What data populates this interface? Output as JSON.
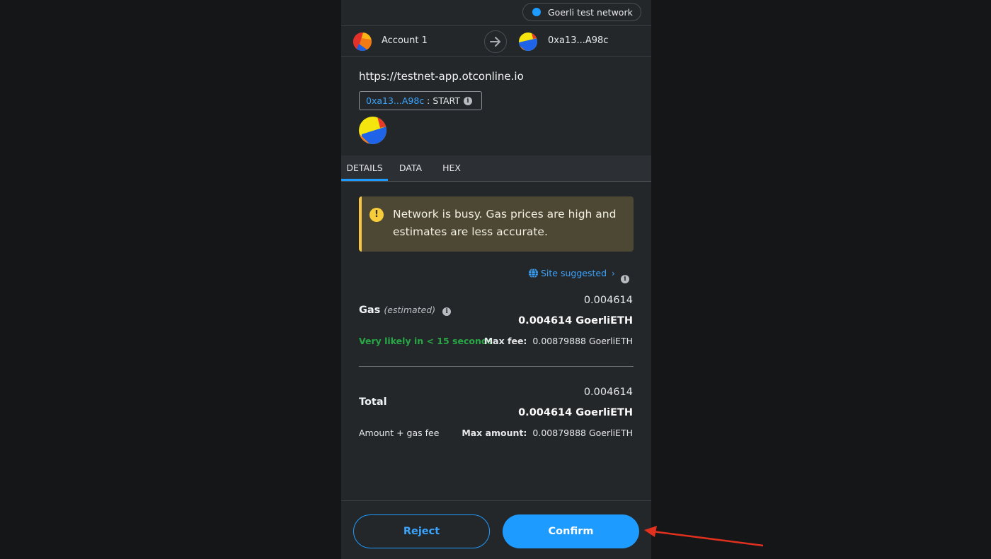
{
  "network": {
    "label": "Goerli test network",
    "dot_color": "#1e9bff"
  },
  "accounts": {
    "from_label": "Account 1",
    "to_label": "0xa13...A98c",
    "avatar_icon": "jazzicon-avatar",
    "arrow_icon": "arrow-right-icon"
  },
  "origin": "https://testnet-app.otconline.io",
  "method": {
    "address": "0xa13...A98c",
    "separator": ":",
    "name": "START",
    "info_icon": "i"
  },
  "tabs": [
    {
      "label": "DETAILS",
      "active": true
    },
    {
      "label": "DATA",
      "active": false
    },
    {
      "label": "HEX",
      "active": false
    }
  ],
  "warning": {
    "icon": "!",
    "text": "Network is busy. Gas prices are high and estimates are less accurate."
  },
  "site_suggested": {
    "label": "Site suggested",
    "chevron": "›",
    "info_icon": "i"
  },
  "gas": {
    "label": "Gas",
    "estimated": "(estimated)",
    "info_icon": "i",
    "value": "0.004614",
    "value_eth": "0.004614 GoerliETH",
    "likely": "Very likely in < 15 seconds",
    "max_fee_label": "Max fee:",
    "max_fee_value": "0.00879888 GoerliETH"
  },
  "total": {
    "label": "Total",
    "value": "0.004614",
    "value_eth": "0.004614 GoerliETH",
    "sub_label": "Amount + gas fee",
    "max_amount_label": "Max amount:",
    "max_amount_value": "0.00879888 GoerliETH"
  },
  "buttons": {
    "reject": "Reject",
    "confirm": "Confirm"
  },
  "colors": {
    "accent": "#1e9bff",
    "success": "#28a745",
    "warning": "#f6c342",
    "annotation_arrow": "#e0301e"
  }
}
